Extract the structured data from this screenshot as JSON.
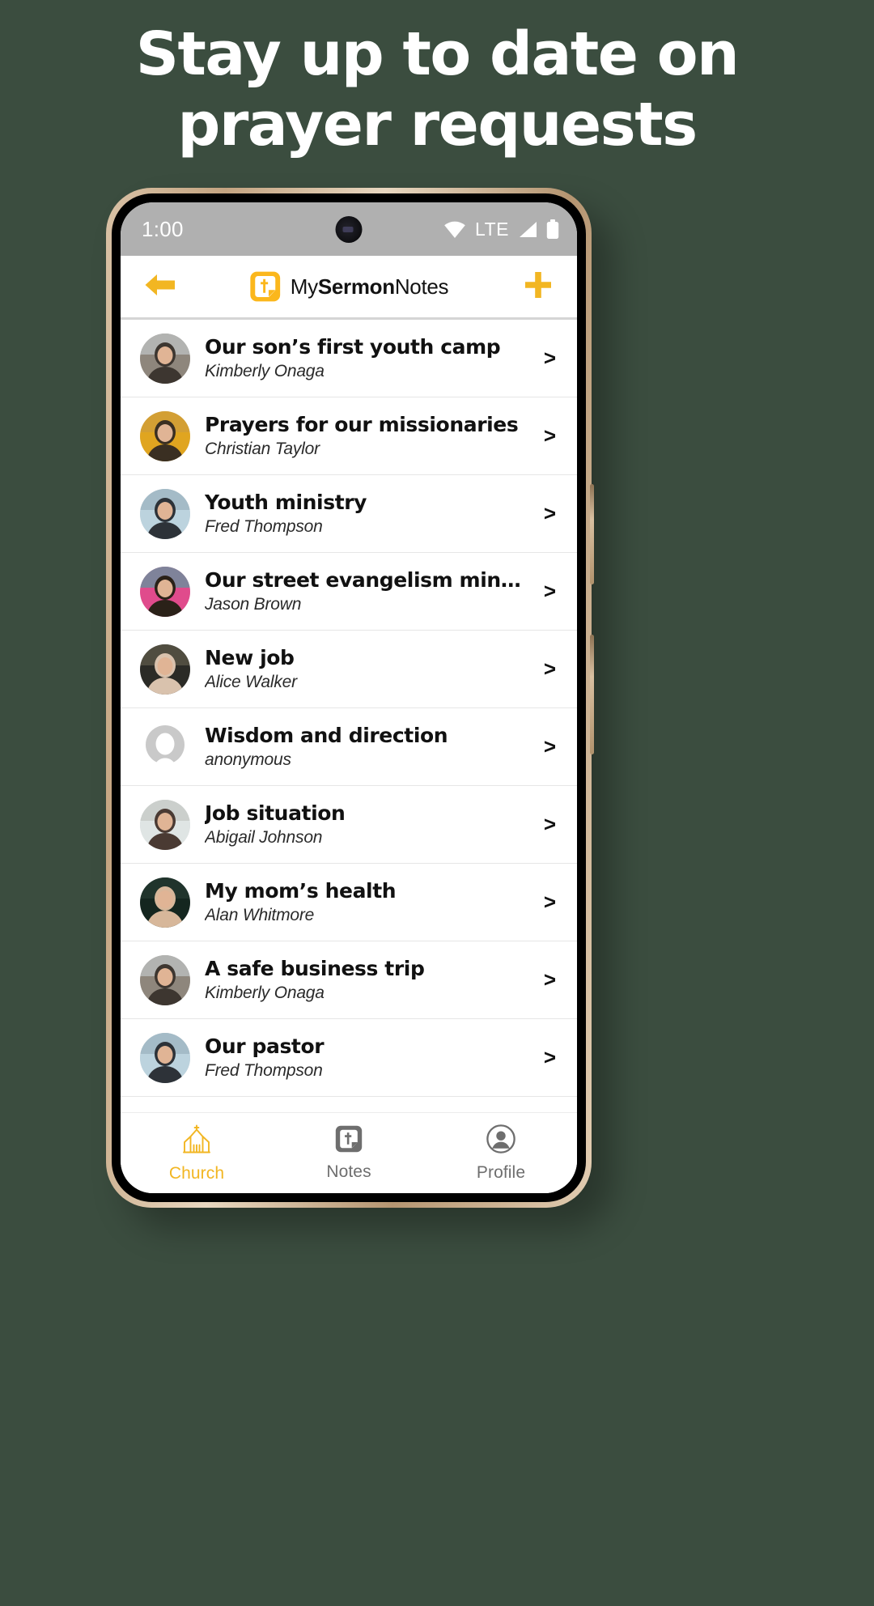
{
  "promo": {
    "headline_line1": "Stay up to date on",
    "headline_line2": "prayer requests",
    "background_color": "#3b4d3f",
    "text_color": "#ffffff"
  },
  "theme": {
    "accent": "#f2b622",
    "status_bar_bg": "#b0b0b0",
    "screen_bg": "#ffffff",
    "muted_text": "#6e6e6e"
  },
  "status_bar": {
    "time": "1:00",
    "network_label": "LTE",
    "icons": [
      "wifi-icon",
      "signal-icon",
      "battery-icon"
    ]
  },
  "app_bar": {
    "back_icon": "arrow-left-icon",
    "logo_icon": "mysermonnotes-logo-icon",
    "brand_prefix": "My",
    "brand_bold": "Sermon",
    "brand_suffix": "Notes",
    "add_icon": "plus-icon"
  },
  "prayer_requests": [
    {
      "title": "Our son’s first youth camp",
      "author": "Kimberly Onaga",
      "chevron": ">",
      "avatar": "photo"
    },
    {
      "title": "Prayers for our missionaries",
      "author": "Christian Taylor",
      "chevron": ">",
      "avatar": "photo"
    },
    {
      "title": "Youth ministry",
      "author": "Fred Thompson",
      "chevron": ">",
      "avatar": "photo"
    },
    {
      "title": "Our street evangelism ministry",
      "author": "Jason Brown",
      "chevron": ">",
      "avatar": "photo"
    },
    {
      "title": "New job",
      "author": "Alice Walker",
      "chevron": ">",
      "avatar": "photo"
    },
    {
      "title": "Wisdom and direction",
      "author": "anonymous",
      "chevron": ">",
      "avatar": "anonymous"
    },
    {
      "title": "Job situation",
      "author": "Abigail Johnson",
      "chevron": ">",
      "avatar": "photo"
    },
    {
      "title": "My mom’s health",
      "author": "Alan Whitmore",
      "chevron": ">",
      "avatar": "photo"
    },
    {
      "title": "A safe business trip",
      "author": "Kimberly Onaga",
      "chevron": ">",
      "avatar": "photo"
    },
    {
      "title": "Our pastor",
      "author": "Fred Thompson",
      "chevron": ">",
      "avatar": "photo"
    }
  ],
  "bottom_nav": {
    "items": [
      {
        "label": "Church",
        "icon": "church-icon",
        "active": true
      },
      {
        "label": "Notes",
        "icon": "notes-icon",
        "active": false
      },
      {
        "label": "Profile",
        "icon": "profile-icon",
        "active": false
      }
    ]
  }
}
